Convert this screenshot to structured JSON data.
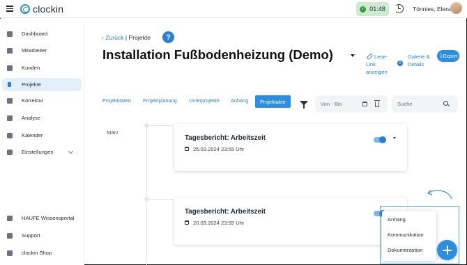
{
  "app": {
    "logo_text": "clockin"
  },
  "topbar": {
    "timer": "01:48",
    "user_name": "Tönnies, Elena"
  },
  "sidebar": {
    "items": [
      {
        "label": "Dashboard",
        "icon": "dashboard-icon"
      },
      {
        "label": "Mitarbeiter",
        "icon": "users-icon"
      },
      {
        "label": "Kunden",
        "icon": "handshake-icon"
      },
      {
        "label": "Projekte",
        "icon": "project-icon",
        "active": true
      },
      {
        "label": "Korrektur",
        "icon": "edit-icon"
      },
      {
        "label": "Analyse",
        "icon": "analytics-icon"
      },
      {
        "label": "Kalender",
        "icon": "calendar-icon"
      },
      {
        "label": "Einstellungen",
        "icon": "gear-icon"
      }
    ],
    "bottom_items": [
      {
        "label": "HAUFE Wissensportal",
        "icon": "book-icon"
      },
      {
        "label": "Support",
        "icon": "chat-icon"
      },
      {
        "label": "clockin Shop",
        "icon": "cart-icon"
      }
    ]
  },
  "breadcrumb": {
    "back": "Zurück",
    "separator": "|",
    "current": "Projekte"
  },
  "page": {
    "title": "Installation Fußbodenheizung (Demo)",
    "read_link": "Lese-Link anzeigen",
    "gallery": "Galerie & Details",
    "export": "Export"
  },
  "tabs": [
    "Projektdaten",
    "Projektplanung",
    "Unterprojekte",
    "Anhang",
    "Projektakte"
  ],
  "active_tab": "Projektakte",
  "filter": {
    "date_placeholder": "Von - Bis",
    "search_placeholder": "Suche"
  },
  "timeline": {
    "month": "März",
    "entries": [
      {
        "title": "Tagesbericht: Arbeitszeit",
        "date": "25.03.2024 23:55 Uhr"
      },
      {
        "title": "Tagesbericht: Arbeitszeit",
        "date": "20.03.2024 23:55 Uhr"
      }
    ]
  },
  "fab_menu": {
    "items": [
      "Anhang",
      "Kommunikation",
      "Dokumentation"
    ]
  },
  "colors": {
    "accent": "#2b8ee0",
    "timer_bg": "#cdeccf",
    "active_nav_bg": "#e3effb"
  }
}
